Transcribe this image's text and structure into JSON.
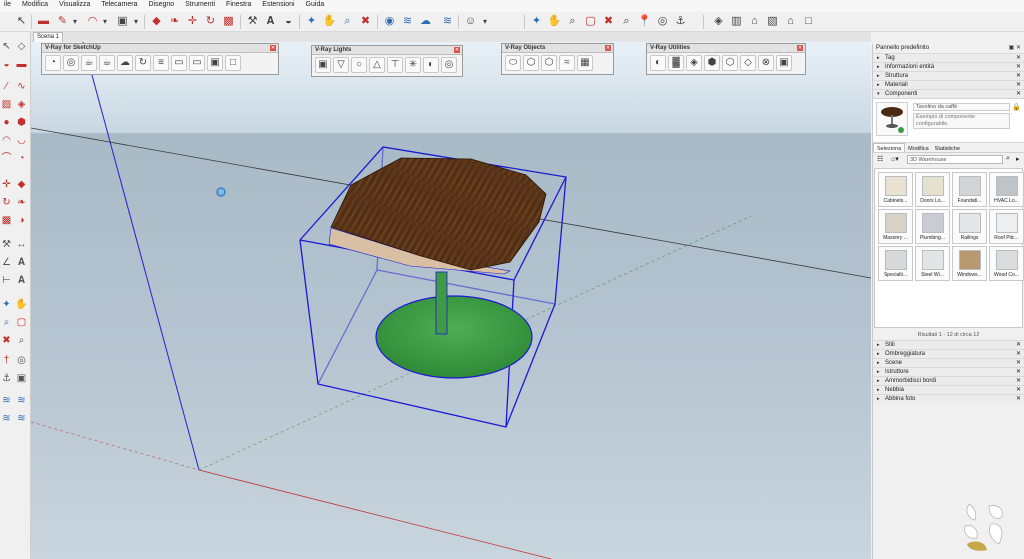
{
  "menu": [
    "ile",
    "Modifica",
    "Visualizza",
    "Telecamera",
    "Disegno",
    "Strumenti",
    "Finestra",
    "Estensioni",
    "Guida"
  ],
  "scene_tab": "Scena 1",
  "panels": {
    "vray_sketchup": "V-Ray for SketchUp",
    "vray_lights": "V-Ray Lights",
    "vray_objects": "V-Ray Objects",
    "vray_utilities": "V-Ray Utilities"
  },
  "tray": {
    "title": "Pannello predefinito",
    "sections_top": [
      "Tag",
      "Informazioni entità",
      "Struttura",
      "Materiali"
    ],
    "components_title": "Componenti",
    "component_name": "Tavolino da caffè",
    "component_desc": "Esempio di componente configurabile.",
    "tabs": [
      "Seleziona",
      "Modifica",
      "Statistiche"
    ],
    "search_placeholder": "3D Warehouse",
    "items": [
      "Cabinets...",
      "Doors Lo...",
      "Foundati...",
      "HVAC Lo...",
      "Masonry ...",
      "Plumbing...",
      "Railings",
      "Roof Pitc...",
      "Specialti...",
      "Steel Wi...",
      "Windows...",
      "Wood Co..."
    ],
    "results": "Risultati 1 - 12 di circa 12",
    "sections_bottom": [
      "Stili",
      "Ombreggiatura",
      "Scene",
      "Istruttore",
      "Ammorbidisci bordi",
      "Nebbia",
      "Abbina foto"
    ]
  },
  "colors": {
    "selection": "#1a1ad6",
    "table_top": "#5a3418",
    "base": "#3f9a45",
    "x_axis_red": "#c03030",
    "y_axis_green": "#2f8f2f",
    "z_axis_blue": "#2222cc"
  }
}
